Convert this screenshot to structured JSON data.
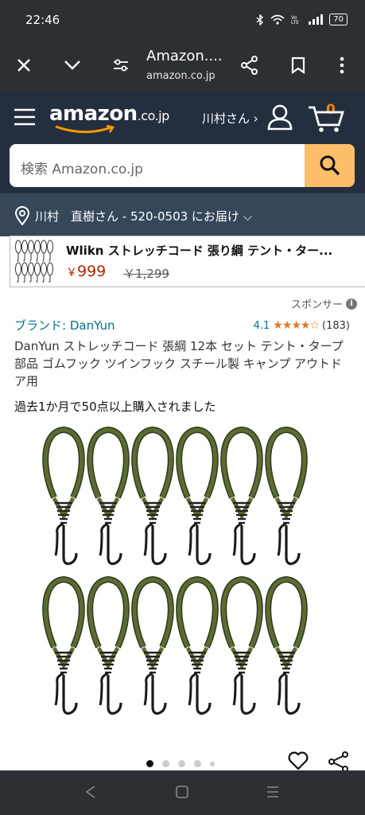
{
  "status_bar": {
    "time": "22:46",
    "battery": "70"
  },
  "browser": {
    "tab_title": "Amazon....",
    "host": "amazon.co.jp",
    "icons": [
      "close-icon",
      "chevron-down-icon",
      "site-settings-icon",
      "share-icon",
      "bookmark-icon",
      "more-icon"
    ]
  },
  "header": {
    "logo": "amazon",
    "logo_suffix": ".co.jp",
    "user_label": "川村さん ›",
    "cart_count": "0",
    "search_placeholder": "検索 Amazon.co.jp",
    "accent_color": "#febd69"
  },
  "delivery": {
    "text": "川村　直樹さん - 520-0503 にお届け ⌵"
  },
  "banner": {
    "title": "Wlikn ストレッチコード 張り綱 テント・ター...",
    "price_symbol": "￥",
    "price": "999",
    "old_price": "￥1,299"
  },
  "product": {
    "sponsored": "スポンサー",
    "brand": "ブランド: DanYun",
    "rating_value": "4.1",
    "rating_stars": "★★★★☆",
    "rating_count": "(183)",
    "title": "DanYun ストレッチコード 張綱 12本 セット テント・タープ部品 ゴムフック ツインフック スチール製 キャンプ アウトドア用",
    "bought_text": "過去1か月で50点以上購入されました",
    "image_dots": 5,
    "active_dot": 0
  }
}
